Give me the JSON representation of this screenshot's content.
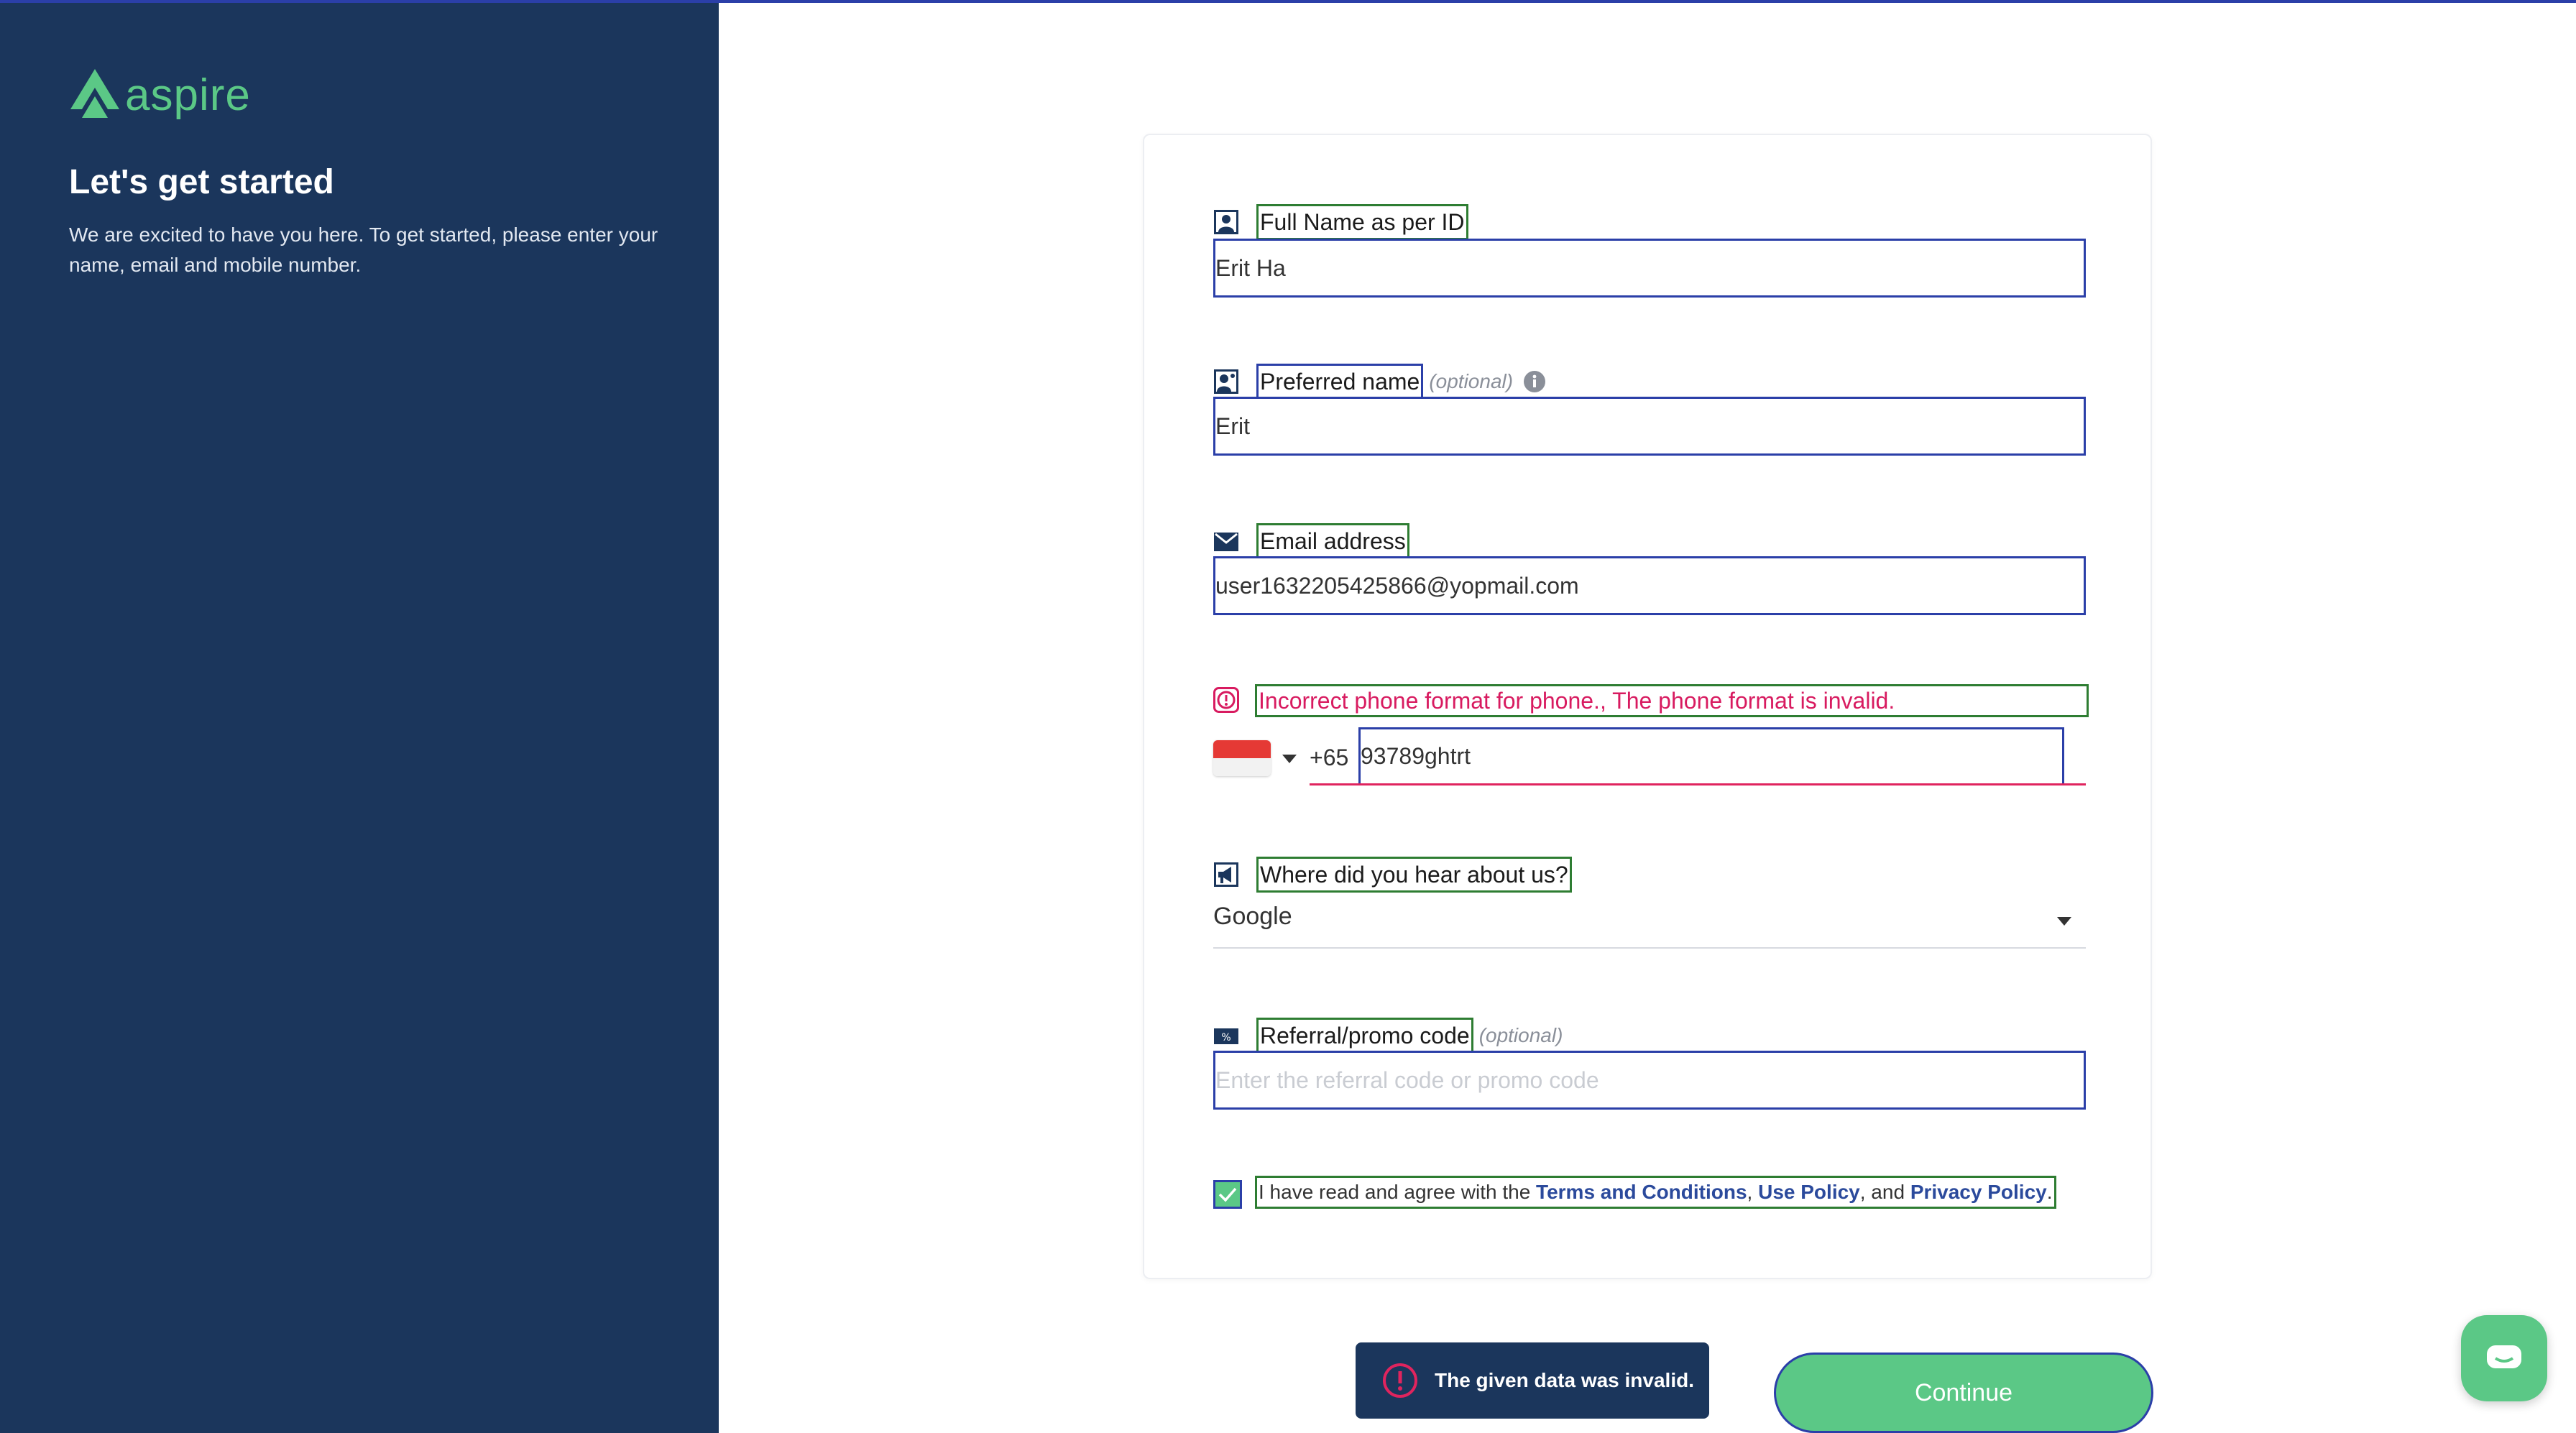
{
  "sidebar": {
    "logo_text": "aspire",
    "title": "Let's get started",
    "description": "We are excited to have you here. To get started, please enter your name, email and mobile number."
  },
  "form": {
    "full_name": {
      "label": "Full Name as per ID",
      "value": "Erit Ha",
      "icon": "id-card-icon"
    },
    "preferred_name": {
      "label": "Preferred name",
      "optional": "(optional)",
      "value": "Erit",
      "icon": "user-badge-icon"
    },
    "email": {
      "label": "Email address",
      "value": "user1632205425866@yopmail.com",
      "icon": "envelope-icon"
    },
    "phone": {
      "error": "Incorrect phone format for phone., The phone format is invalid.",
      "country_flag": "singapore-flag-icon",
      "dial_code": "+65",
      "value": "93789ghtrt"
    },
    "source": {
      "label": "Where did you hear about us?",
      "value": "Google",
      "icon": "megaphone-icon"
    },
    "referral": {
      "label": "Referral/promo code",
      "optional": "(optional)",
      "placeholder": "Enter the referral code or promo code",
      "icon": "percent-tag-icon"
    },
    "agreement": {
      "checked": true,
      "prefix": "I have read and agree with the ",
      "terms": "Terms and Conditions",
      "sep1": ", ",
      "use_policy": "Use Policy",
      "sep2": ", and ",
      "privacy": "Privacy Policy",
      "suffix": "."
    }
  },
  "toast": {
    "message": "The given data was invalid."
  },
  "actions": {
    "continue": "Continue"
  },
  "colors": {
    "sidebar_bg": "#1b365c",
    "brand_green": "#5bc886",
    "error": "#d81b60",
    "link": "#2b4a9c"
  }
}
